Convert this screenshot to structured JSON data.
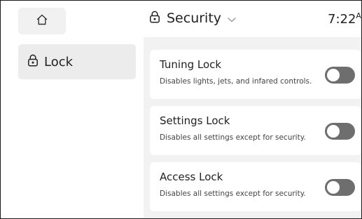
{
  "sidebar": {
    "home_icon": "home-icon",
    "items": [
      {
        "label": "Lock",
        "icon": "lock-icon",
        "selected": true
      }
    ]
  },
  "header": {
    "title": "Security",
    "title_icon": "lock-icon",
    "dropdown_icon": "chevron-down-icon",
    "time": "7:22",
    "time_suffix": "A"
  },
  "settings": [
    {
      "title": "Tuning Lock",
      "description": "Disables lights, jets, and infared controls.",
      "enabled": false
    },
    {
      "title": "Settings Lock",
      "description": "Disables all settings except for security.",
      "enabled": false
    },
    {
      "title": "Access Lock",
      "description": "Disables all settings except for security.",
      "enabled": false
    }
  ],
  "colors": {
    "sidebar_selected": "#ececec",
    "main_background": "#f2f2f2",
    "toggle_off": "#6e6e6e",
    "card": "#ffffff"
  }
}
